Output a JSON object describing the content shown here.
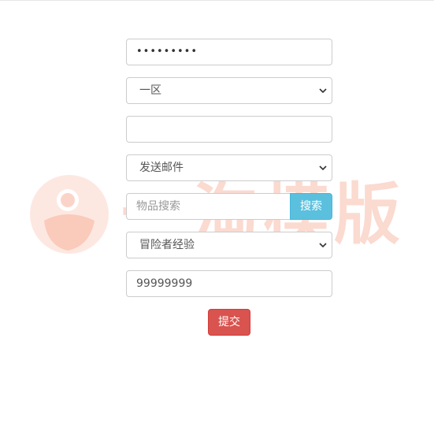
{
  "watermark": {
    "text": "一淘模版"
  },
  "form": {
    "password": {
      "masked": "•••••••••"
    },
    "region_select": {
      "selected": "一区"
    },
    "text_input": {
      "value": ""
    },
    "action_select": {
      "selected": "发送邮件"
    },
    "item_search": {
      "placeholder": "物品搜索",
      "button": "搜索"
    },
    "reward_select": {
      "selected": "冒险者经验"
    },
    "amount_input": {
      "value": "99999999"
    },
    "submit": "提交"
  }
}
